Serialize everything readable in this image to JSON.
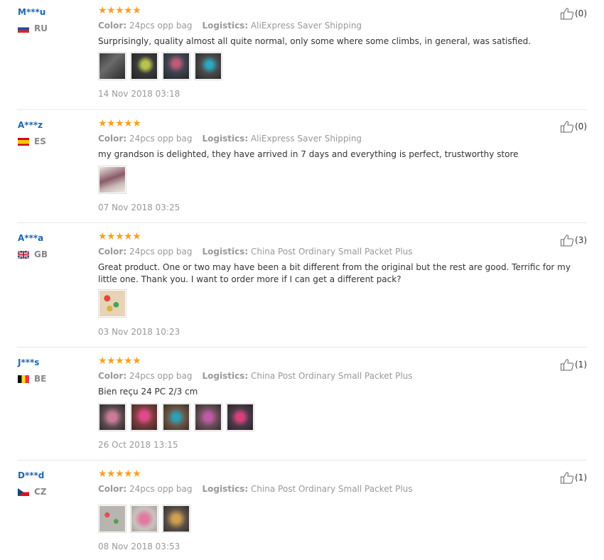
{
  "labels": {
    "color": "Color:",
    "logistics": "Logistics:"
  },
  "reviews": [
    {
      "user": "M***u",
      "country": "RU",
      "flag": "ru",
      "stars": "★★★★★",
      "color": "24pcs opp bag",
      "logistics": "AliExpress Saver Shipping",
      "content": "Surprisingly, quality almost all quite normal, only some where some climbs, in general, was satisfied.",
      "photos": [
        {
          "bg": "linear-gradient(135deg,#3a3a3a,#6a6a6a 40%,#2b2b2b)"
        },
        {
          "bg": "radial-gradient(circle at 55% 45%,#b7c34a 0 18%,#3a3a3a 45%,#222)"
        },
        {
          "bg": "radial-gradient(circle at 50% 40%,#c05a7a 0 15%,#3f4550 45%,#23262b)"
        },
        {
          "bg": "radial-gradient(circle at 55% 45%,#2aa9c4 0 15%,#4a4a4a 45%,#262626)"
        }
      ],
      "date": "14 Nov 2018 03:18",
      "helpful": "(0)"
    },
    {
      "user": "A***z",
      "country": "ES",
      "flag": "es",
      "stars": "★★★★★",
      "color": "24pcs opp bag",
      "logistics": "AliExpress Saver Shipping",
      "content": "my grandson is delighted, they have arrived in 7 days and everything is perfect, trustworthy store",
      "photos": [
        {
          "bg": "linear-gradient(160deg,#e9e4de,#8a5a6a 45%,#c9b9b5 70%,#f0ece8)"
        }
      ],
      "date": "07 Nov 2018 03:25",
      "helpful": "(0)"
    },
    {
      "user": "A***a",
      "country": "GB",
      "flag": "gb",
      "stars": "★★★★★",
      "color": "24pcs opp bag",
      "logistics": "China Post Ordinary Small Packet Plus",
      "content": "Great product. One or two may have been a bit different from the original but the rest are good. Terrific for my little one. Thank you. I want to order more if I can get a different pack?",
      "photos": [
        {
          "bg": "radial-gradient(circle at 30% 30%,#e6453c 0 12%,transparent 13%),radial-gradient(circle at 65% 55%,#3fa85a 0 12%,transparent 13%),radial-gradient(circle at 40% 70%,#d9b23a 0 12%,transparent 13%),#e8d2b8"
        }
      ],
      "date": "03 Nov 2018 10:23",
      "helpful": "(3)"
    },
    {
      "user": "J***s",
      "country": "BE",
      "flag": "be",
      "stars": "★★★★★",
      "color": "24pcs opp bag",
      "logistics": "China Post Ordinary Small Packet Plus",
      "content": "Bien reçu 24 PC 2/3 cm",
      "photos": [
        {
          "bg": "radial-gradient(circle at 50% 50%,#c97b9a 0 22%,#5b4a4e 55%,#2f2a2b)"
        },
        {
          "bg": "radial-gradient(circle at 50% 45%,#e04a8a 0 20%,#7a3b3b 50%,#3a2a2a)"
        },
        {
          "bg": "radial-gradient(circle at 50% 50%,#2f9fb5 0 18%,#6b5545 50%,#3a3028)"
        },
        {
          "bg": "radial-gradient(circle at 50% 50%,#c05aa8 0 20%,#6a4f5a 50%,#362a30)"
        },
        {
          "bg": "radial-gradient(circle at 50% 50%,#d8407a 0 20%,#4a3a4a 50%,#2a2228)"
        }
      ],
      "date": "26 Oct 2018 13:15",
      "helpful": "(1)"
    },
    {
      "user": "D***d",
      "country": "CZ",
      "flag": "cz",
      "stars": "★★★★★",
      "color": "24pcs opp bag",
      "logistics": "China Post Ordinary Small Packet Plus",
      "content": "",
      "photos": [
        {
          "bg": "radial-gradient(circle at 30% 35%,#e05050 0 10%,transparent 11%),radial-gradient(circle at 65% 60%,#50a050 0 10%,transparent 11%),#b8b4b0"
        },
        {
          "bg": "radial-gradient(circle at 50% 50%,#e07aa0 0 22%,#c9c2bd 55%,#a8a29e)"
        },
        {
          "bg": "radial-gradient(circle at 50% 50%,#d0a050 0 20%,#5a5048 55%,#34302c)"
        }
      ],
      "date": "08 Nov 2018 03:53",
      "helpful": "(1)"
    }
  ]
}
